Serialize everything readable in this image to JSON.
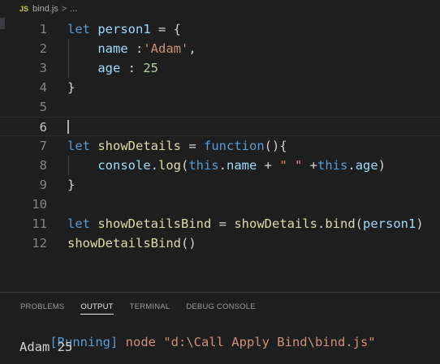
{
  "breadcrumb": {
    "file_icon": "JS",
    "file_name": "bind.js",
    "separator": ">",
    "more": "..."
  },
  "editor": {
    "lines": [
      {
        "n": "1",
        "tokens": [
          [
            "kw",
            "let"
          ],
          [
            "pl",
            " "
          ],
          [
            "var",
            "person1"
          ],
          [
            "pl",
            " = {"
          ]
        ]
      },
      {
        "n": "2",
        "tokens": [
          [
            "pl",
            "    "
          ],
          [
            "var",
            "name"
          ],
          [
            "pl",
            " :"
          ],
          [
            "str",
            "'Adam'"
          ],
          [
            "pl",
            ","
          ]
        ]
      },
      {
        "n": "3",
        "tokens": [
          [
            "pl",
            "    "
          ],
          [
            "var",
            "age"
          ],
          [
            "pl",
            " : "
          ],
          [
            "num",
            "25"
          ]
        ]
      },
      {
        "n": "4",
        "tokens": [
          [
            "pl",
            "}"
          ]
        ]
      },
      {
        "n": "5",
        "tokens": []
      },
      {
        "n": "6",
        "tokens": []
      },
      {
        "n": "7",
        "tokens": [
          [
            "kw",
            "let"
          ],
          [
            "pl",
            " "
          ],
          [
            "fn",
            "showDetails"
          ],
          [
            "pl",
            " = "
          ],
          [
            "kw",
            "function"
          ],
          [
            "pl",
            "(){"
          ]
        ]
      },
      {
        "n": "8",
        "tokens": [
          [
            "pl",
            "    "
          ],
          [
            "var",
            "console"
          ],
          [
            "pl",
            "."
          ],
          [
            "fn",
            "log"
          ],
          [
            "pl",
            "("
          ],
          [
            "kw",
            "this"
          ],
          [
            "pl",
            "."
          ],
          [
            "var",
            "name"
          ],
          [
            "pl",
            " + "
          ],
          [
            "str",
            "\" \""
          ],
          [
            "pl",
            " +"
          ],
          [
            "kw",
            "this"
          ],
          [
            "pl",
            "."
          ],
          [
            "var",
            "age"
          ],
          [
            "pl",
            ")"
          ]
        ]
      },
      {
        "n": "9",
        "tokens": [
          [
            "pl",
            "}"
          ]
        ]
      },
      {
        "n": "10",
        "tokens": []
      },
      {
        "n": "11",
        "tokens": [
          [
            "kw",
            "let"
          ],
          [
            "pl",
            " "
          ],
          [
            "fn",
            "showDetailsBind"
          ],
          [
            "pl",
            " = "
          ],
          [
            "fn",
            "showDetails"
          ],
          [
            "pl",
            "."
          ],
          [
            "fn",
            "bind"
          ],
          [
            "pl",
            "("
          ],
          [
            "var",
            "person1"
          ],
          [
            "pl",
            ")"
          ]
        ]
      },
      {
        "n": "12",
        "tokens": [
          [
            "fn",
            "showDetailsBind"
          ],
          [
            "pl",
            "()"
          ]
        ]
      }
    ],
    "current_line": 6
  },
  "panel": {
    "tabs": [
      "PROBLEMS",
      "OUTPUT",
      "TERMINAL",
      "DEBUG CONSOLE"
    ],
    "active_tab": 1,
    "output": {
      "running_tag": "[Running]",
      "command": " node \"d:\\Call Apply Bind\\bind.js\"",
      "result": "Adam 25"
    }
  },
  "colors": {
    "background": "#1e1e1e",
    "keyword": "#569cd6",
    "variable": "#9cdcfe",
    "function": "#dcdcaa",
    "string": "#ce9178",
    "number": "#b5cea8",
    "line_number": "#858585"
  }
}
